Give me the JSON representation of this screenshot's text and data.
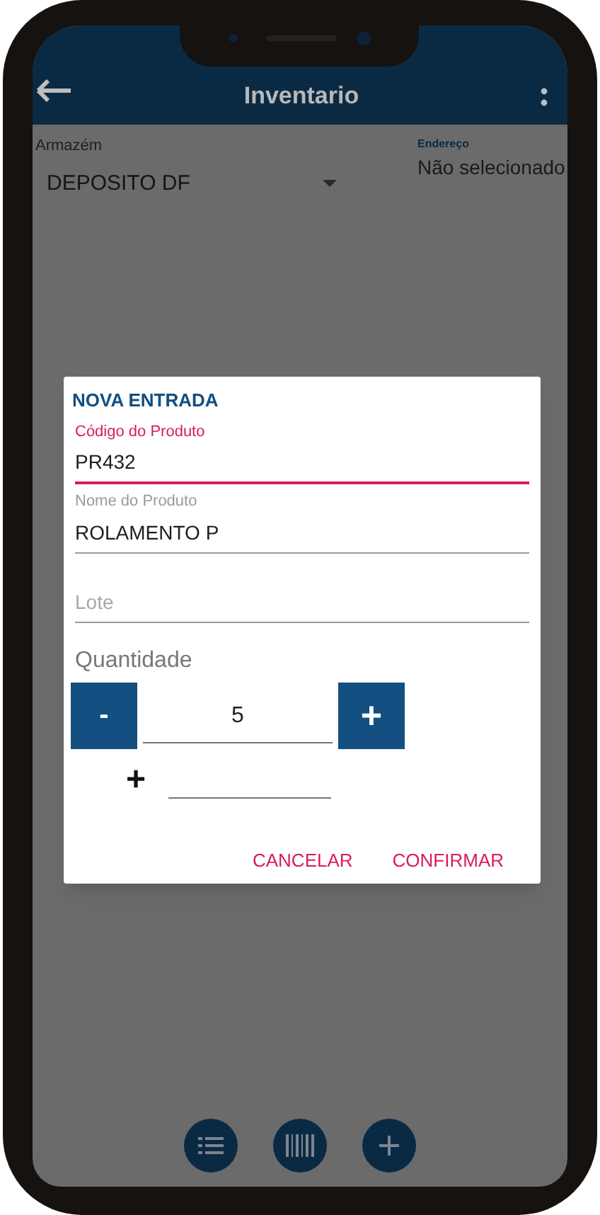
{
  "app_bar": {
    "title": "Inventario"
  },
  "warehouse": {
    "label": "Armazém",
    "value": "DEPOSITO DF"
  },
  "address": {
    "label": "Endereço",
    "value": "Não selecionado"
  },
  "dialog": {
    "title": "NOVA ENTRADA",
    "fields": [
      {
        "label": "Código do Produto",
        "value": "PR432",
        "focused": true
      },
      {
        "label": "Nome do Produto",
        "value": "ROLAMENTO P",
        "focused": false
      },
      {
        "placeholder": "Lote",
        "focused": false
      }
    ],
    "quantity": {
      "label": "Quantidade",
      "decrement": "-",
      "value": "5",
      "increment": "+"
    },
    "extra": {
      "sign": "+"
    },
    "buttons": [
      "CANCELAR",
      "CONFIRMAR"
    ]
  }
}
